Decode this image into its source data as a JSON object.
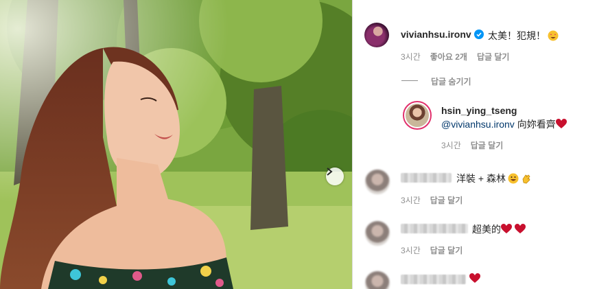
{
  "post": {
    "next_icon": "chevron-right-icon"
  },
  "comments": [
    {
      "username": "vivianhsu.ironv",
      "verified": true,
      "text": "太美！犯規！",
      "emoji": "star-struck-emoji",
      "time": "3시간",
      "likes": "좋아요 2개",
      "reply_label": "답글 달기",
      "hide_replies_label": "답글 숨기기"
    },
    {
      "username": "hsin_ying_tseng",
      "mention": "@vivianhsu.ironv",
      "text": " 向妳看齊",
      "emoji": "heart-emoji",
      "time": "3시간",
      "reply_label": "답글 달기"
    },
    {
      "username": "",
      "text": "洋裝 + 森林",
      "emoji": "grin-emoji",
      "emoji2": "clap-emoji",
      "time": "3시간",
      "reply_label": "답글 달기"
    },
    {
      "username": "",
      "text": "超美的",
      "emoji": "heart-emoji",
      "time": "3시간",
      "reply_label": "답글 달기"
    },
    {
      "username": "",
      "text": "",
      "emoji": "heart-emoji"
    }
  ],
  "colors": {
    "accent_blue": "#0095f6",
    "mention": "#00376b",
    "muted": "#8e8e8e",
    "heart": "#e0245e"
  }
}
